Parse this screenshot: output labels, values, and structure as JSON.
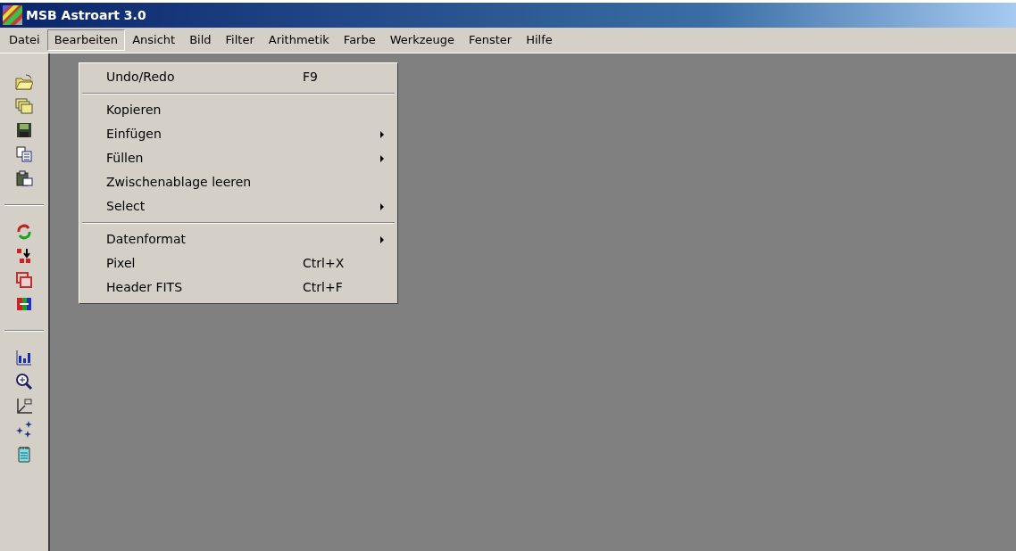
{
  "window": {
    "title": "MSB Astroart 3.0"
  },
  "menu_bar": [
    {
      "label": "Datei",
      "selected": false
    },
    {
      "label": "Bearbeiten",
      "selected": true
    },
    {
      "label": "Ansicht",
      "selected": false
    },
    {
      "label": "Bild",
      "selected": false
    },
    {
      "label": "Filter",
      "selected": false
    },
    {
      "label": "Arithmetik",
      "selected": false
    },
    {
      "label": "Farbe",
      "selected": false
    },
    {
      "label": "Werkzeuge",
      "selected": false
    },
    {
      "label": "Fenster",
      "selected": false
    },
    {
      "label": "Hilfe",
      "selected": false
    }
  ],
  "dropdown": [
    {
      "kind": "item",
      "label": "Undo/Redo",
      "shortcut": "F9",
      "submenu": false
    },
    {
      "kind": "separator"
    },
    {
      "kind": "item",
      "label": "Kopieren",
      "submenu": false
    },
    {
      "kind": "item",
      "label": "Einfügen",
      "submenu": true
    },
    {
      "kind": "item",
      "label": "Füllen",
      "submenu": true
    },
    {
      "kind": "item",
      "label": "Zwischenablage leeren",
      "submenu": false
    },
    {
      "kind": "item",
      "label": "Select",
      "submenu": true
    },
    {
      "kind": "separator"
    },
    {
      "kind": "item",
      "label": "Datenformat",
      "submenu": true
    },
    {
      "kind": "item",
      "label": "Pixel",
      "shortcut": "Ctrl+X",
      "submenu": false
    },
    {
      "kind": "item",
      "label": "Header FITS",
      "shortcut": "Ctrl+F",
      "submenu": false
    }
  ]
}
